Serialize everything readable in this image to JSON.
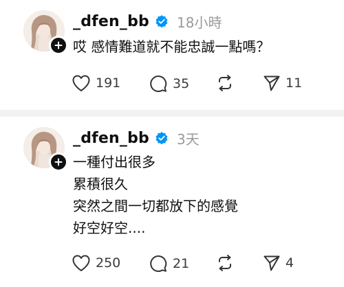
{
  "posts": [
    {
      "username": "_dfen_bb",
      "time": "18小時",
      "lines": [
        "哎 感情難道就不能忠誠一點嗎？"
      ],
      "likes": "191",
      "comments": "35",
      "shares": "11"
    },
    {
      "username": "_dfen_bb",
      "time": "3天",
      "lines": [
        "一種付出很多",
        "累積很久",
        "突然之間一切都放下的感覺",
        "好空好空...."
      ],
      "likes": "250",
      "comments": "21",
      "shares": "4"
    }
  ],
  "icons": {
    "like": "heart-icon",
    "comment": "comment-icon",
    "repost": "repost-icon",
    "share": "send-icon",
    "verified": "verified-badge-icon",
    "follow": "plus-icon"
  },
  "colors": {
    "verified": "#0095f6",
    "text": "#101010",
    "muted": "#9a9a9a",
    "divider": "#f2f2f2"
  }
}
